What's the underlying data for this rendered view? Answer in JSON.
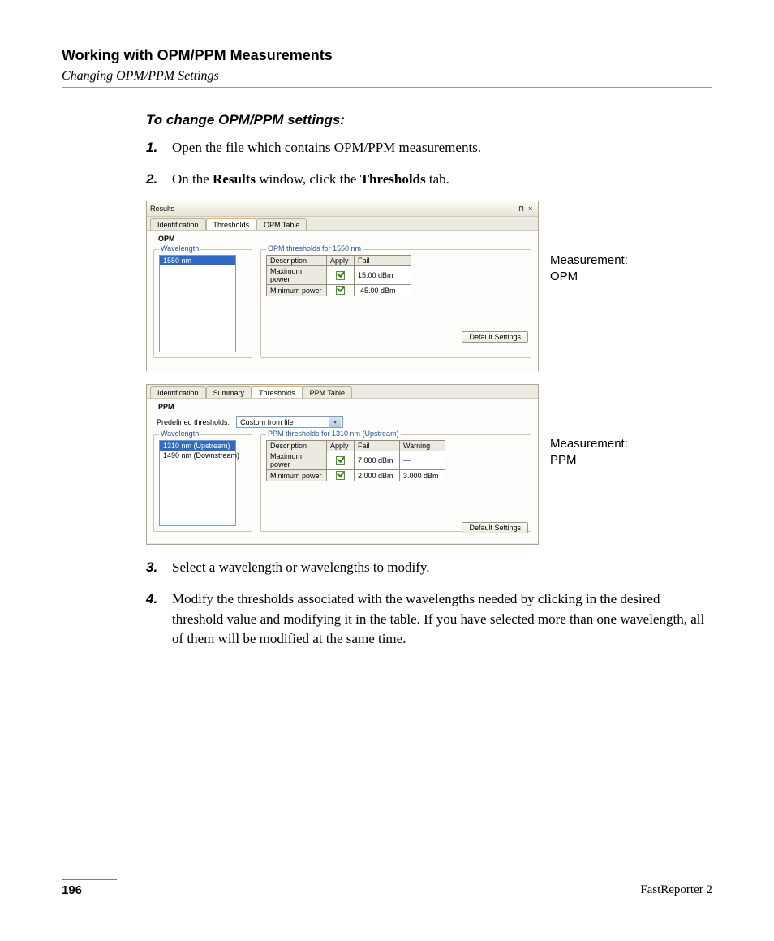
{
  "header": {
    "title": "Working with OPM/PPM Measurements",
    "subtitle": "Changing OPM/PPM Settings"
  },
  "section_title": "To change OPM/PPM settings:",
  "steps": {
    "s1": {
      "num": "1.",
      "text": "Open the file which contains OPM/PPM measurements."
    },
    "s2": {
      "num": "2.",
      "pre": "On the ",
      "b1": "Results",
      "mid": " window, click the ",
      "b2": "Thresholds",
      "post": " tab."
    },
    "s3": {
      "num": "3.",
      "text": "Select a wavelength or wavelengths to modify."
    },
    "s4": {
      "num": "4.",
      "text": "Modify the thresholds associated with the wavelengths needed by clicking in the desired threshold value and modifying it in the table. If you have selected more than one wavelength, all of them will be modified at the same time."
    }
  },
  "callouts": {
    "opm_line1": "Measurement:",
    "opm_line2": "OPM",
    "ppm_line1": "Measurement:",
    "ppm_line2": "PPM"
  },
  "opm_panel": {
    "window_title": "Results",
    "pin_icon": "⊓",
    "close_icon": "×",
    "tabs": {
      "identification": "Identification",
      "thresholds": "Thresholds",
      "opm_table": "OPM Table"
    },
    "sub_label": "OPM",
    "wavelength_legend": "Wavelength",
    "wavelengths": {
      "w0": "1550 nm"
    },
    "threshold_legend": "OPM thresholds for 1550 nm",
    "cols": {
      "description": "Description",
      "apply": "Apply",
      "fail": "Fail"
    },
    "rows": {
      "r0": {
        "desc": "Maximum power",
        "fail": "15.00 dBm"
      },
      "r1": {
        "desc": "Minimum power",
        "fail": "-45.00 dBm"
      }
    },
    "default_btn": "Default Settings"
  },
  "ppm_panel": {
    "tabs": {
      "identification": "Identification",
      "summary": "Summary",
      "thresholds": "Thresholds",
      "ppm_table": "PPM Table"
    },
    "sub_label": "PPM",
    "predef_label": "Predefined thresholds:",
    "predef_value": "Custom from file",
    "wavelength_legend": "Wavelength",
    "wavelengths": {
      "w0": "1310 nm (Upstream)",
      "w1": "1490 nm (Downstream)"
    },
    "threshold_legend": "PPM thresholds for 1310 nm (Upstream)",
    "cols": {
      "description": "Description",
      "apply": "Apply",
      "fail": "Fail",
      "warning": "Warning"
    },
    "rows": {
      "r0": {
        "desc": "Maximum power",
        "fail": "7.000 dBm",
        "warn": "---"
      },
      "r1": {
        "desc": "Minimum power",
        "fail": "2.000 dBm",
        "warn": "3.000 dBm"
      }
    },
    "default_btn": "Default Settings"
  },
  "footer": {
    "page": "196",
    "product": "FastReporter 2"
  }
}
